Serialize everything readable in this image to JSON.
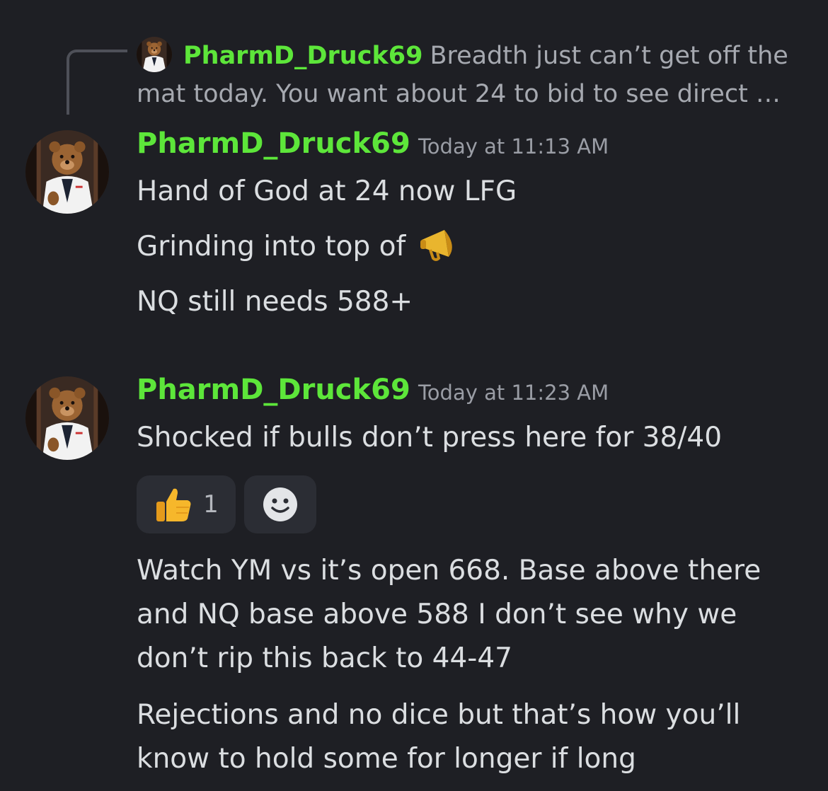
{
  "reply": {
    "author": "PharmD_Druck69",
    "preview": "Breadth just can’t get off the mat today. You want about 24 to bid to see direct …"
  },
  "messages": [
    {
      "author": "PharmD_Druck69",
      "timestamp": "Today at 11:13 AM",
      "lines": [
        "Hand of God at 24 now LFG",
        "Grinding into top of",
        "NQ still needs 588+"
      ],
      "emoji": "megaphone-emoji"
    },
    {
      "author": "PharmD_Druck69",
      "timestamp": "Today at 11:23 AM",
      "lines": [
        "Shocked if bulls don’t press here for 38/40"
      ],
      "reactions": [
        {
          "emoji": "thumbs-up-icon",
          "count": "1"
        },
        {
          "emoji": "add-reaction-icon"
        }
      ]
    }
  ],
  "followups": [
    "Watch YM vs it’s open 668. Base above there and NQ base above 588 I don’t see why we don’t rip this back to 44-47",
    "Rejections and no dice but that’s how you’ll know to hold some for longer if long"
  ],
  "colors": {
    "background": "#1e1f24",
    "username": "#5de63a",
    "text": "#dbdee1",
    "muted": "#9a9da5",
    "reaction_bg": "#2b2d34"
  }
}
